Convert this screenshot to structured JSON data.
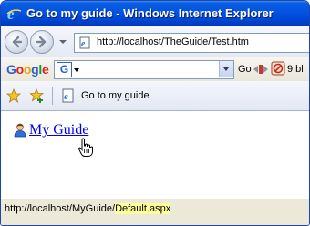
{
  "window": {
    "title": "Go to my guide - Windows Internet Explorer"
  },
  "addressbar": {
    "url": "http://localhost/TheGuide/Test.htm"
  },
  "googlebar": {
    "logo_letters": [
      "G",
      "o",
      "o",
      "g",
      "l",
      "e"
    ],
    "logo_colors": [
      "#2f5fd3",
      "#d9231d",
      "#e5a600",
      "#2f5fd3",
      "#139a27",
      "#d9231d"
    ],
    "g_icon_letter": "G",
    "go_label": "Go",
    "blocked_label": "9 bl"
  },
  "favbar": {
    "tab_label": "Go to my guide"
  },
  "content": {
    "link_text": "My Guide"
  },
  "statusbar": {
    "url_prefix": "http://localhost/MyGuide/",
    "url_highlight": "Default.aspx"
  },
  "colors": {
    "titlebar": "#0153e2",
    "link": "#0000ee",
    "status_highlight": "#ffff99"
  },
  "icons": [
    "ie-icon",
    "back-arrow-icon",
    "forward-arrow-icon",
    "chevron-down-icon",
    "page-icon",
    "star-icon",
    "add-favorite-icon",
    "page-tab-icon",
    "user-icon",
    "hand-cursor-icon",
    "blocked-popup-icon"
  ]
}
